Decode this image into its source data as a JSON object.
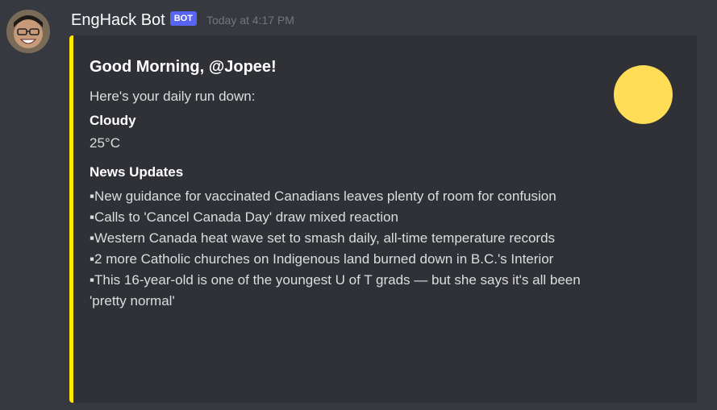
{
  "message": {
    "username": "EngHack Bot",
    "badge": "BOT",
    "timestamp": "Today at 4:17 PM",
    "avatar_icon": "user-avatar"
  },
  "embed": {
    "accent_color": "#ffea00",
    "title": "Good Morning, @Jopee!",
    "description": "Here's your daily run down:",
    "weather": {
      "name": "Cloudy",
      "value": "25°C"
    },
    "news": {
      "name": "News Updates",
      "items": [
        "▪New guidance for vaccinated Canadians leaves plenty of room for confusion",
        "▪Calls to 'Cancel Canada Day' draw mixed reaction",
        "▪Western Canada heat wave set to smash daily, all-time temperature records",
        "▪2 more Catholic churches on Indigenous land burned down in B.C.'s Interior",
        "▪This 16-year-old is one of the youngest U of T grads — but she says it's all been 'pretty normal'"
      ]
    },
    "thumbnail_color": "#ffdd57",
    "thumbnail_icon": "sun-icon"
  }
}
